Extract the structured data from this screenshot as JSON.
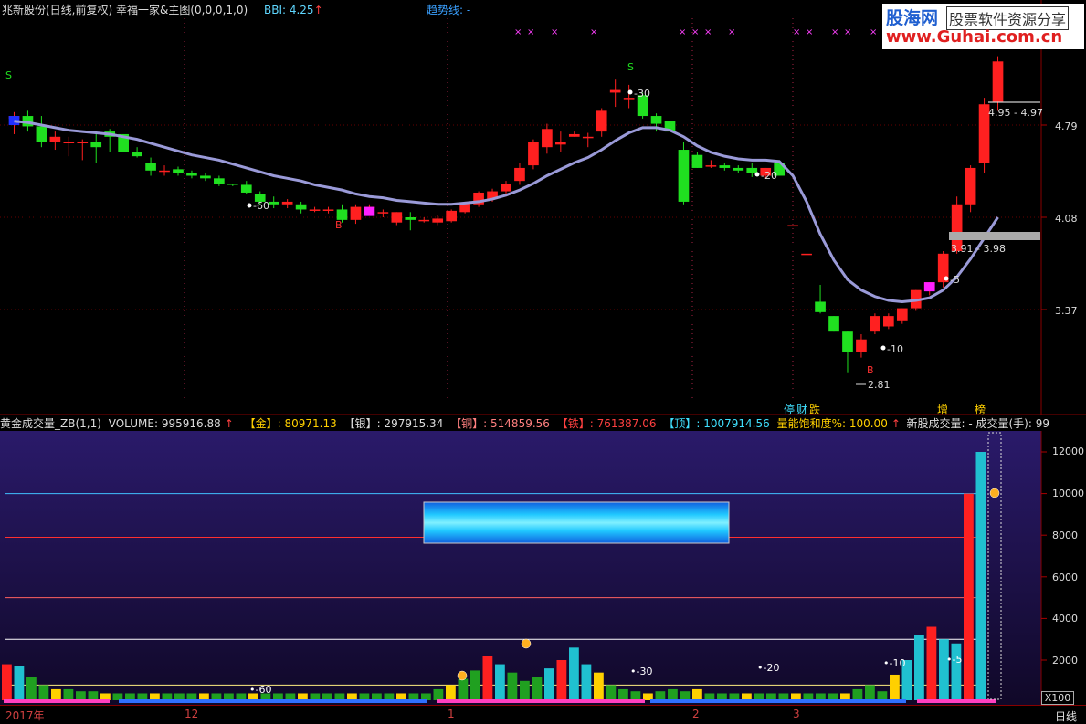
{
  "header": {
    "title": "兆新股份(日线,前复权) 幸福一家&主图(0,0,0,1,0)",
    "bbi_label": "BBI: 4.25",
    "bbi_arrow": "↑",
    "trend_label": "趋势线: -"
  },
  "logo": {
    "line1_cn": "股海网",
    "line1_sub": "股票软件资源分享",
    "line2": "www.Guhai.com.cn"
  },
  "price_axis": {
    "ticks": [
      "4.79",
      "4.08",
      "3.37"
    ]
  },
  "price_annotations": [
    "4.95 - 4.97",
    "3.91 - 3.98",
    "2.81",
    "-60",
    "-30",
    "-20",
    "-10",
    "-5"
  ],
  "signals": {
    "sell": "S",
    "buy": "B"
  },
  "bottom_markers": [
    "停",
    "财",
    "跌",
    "增",
    "榜"
  ],
  "volume_header": {
    "indicator": "黄金成交量_ZB(1,1)",
    "volume": "VOLUME: 995916.88",
    "volume_arrow": "↑",
    "gold": "【金】: 80971.13",
    "silver": "【银】: 297915.34",
    "copper": "【铜】: 514859.56",
    "iron": "【铁】: 761387.06",
    "top": "【顶】: 1007914.56",
    "saturation": "量能饱和度%: 100.00",
    "saturation_arrow": "↑",
    "new_stock": "新股成交量: -  成交量(手): 99"
  },
  "volume_axis": {
    "ticks": [
      "12000",
      "10000",
      "8000",
      "6000",
      "4000",
      "2000"
    ],
    "unit_label": "X100"
  },
  "date_axis": {
    "labels": [
      "2017年",
      "12",
      "1",
      "2",
      "3"
    ],
    "period": "日线"
  },
  "colors": {
    "up": "#ff2020",
    "down": "#20e020",
    "bbi_line": "#9a9ad8",
    "panel_top": "#2a1a6a",
    "panel_bottom": "#100828"
  },
  "chart_data": {
    "type": "candlestick",
    "series": [
      {
        "name": "price",
        "ohlc": [
          [
            4.84,
            4.89,
            4.72,
            4.86
          ],
          [
            4.86,
            4.9,
            4.74,
            4.78
          ],
          [
            4.78,
            4.86,
            4.62,
            4.66
          ],
          [
            4.66,
            4.74,
            4.6,
            4.7
          ],
          [
            4.66,
            4.7,
            4.55,
            4.66
          ],
          [
            4.66,
            4.68,
            4.52,
            4.66
          ],
          [
            4.66,
            4.74,
            4.5,
            4.62
          ],
          [
            4.74,
            4.76,
            4.58,
            4.7
          ],
          [
            4.72,
            4.72,
            4.58,
            4.58
          ],
          [
            4.58,
            4.62,
            4.54,
            4.55
          ],
          [
            4.5,
            4.54,
            4.4,
            4.44
          ],
          [
            4.44,
            4.48,
            4.4,
            4.44
          ],
          [
            4.45,
            4.47,
            4.4,
            4.42
          ],
          [
            4.42,
            4.44,
            4.38,
            4.4
          ],
          [
            4.4,
            4.42,
            4.36,
            4.38
          ],
          [
            4.38,
            4.4,
            4.32,
            4.34
          ],
          [
            4.34,
            4.34,
            4.32,
            4.33
          ],
          [
            4.33,
            4.36,
            4.26,
            4.27
          ],
          [
            4.26,
            4.28,
            4.18,
            4.2
          ],
          [
            4.2,
            4.24,
            4.15,
            4.18
          ],
          [
            4.18,
            4.22,
            4.15,
            4.2
          ],
          [
            4.18,
            4.2,
            4.11,
            4.14
          ],
          [
            4.14,
            4.16,
            4.12,
            4.14
          ],
          [
            4.14,
            4.16,
            4.11,
            4.14
          ],
          [
            4.14,
            4.18,
            4.04,
            4.06
          ],
          [
            4.06,
            4.18,
            4.03,
            4.16
          ],
          [
            4.16,
            4.18,
            4.1,
            4.16
          ],
          [
            4.12,
            4.14,
            4.08,
            4.12
          ],
          [
            4.04,
            4.12,
            4.02,
            4.12
          ],
          [
            4.08,
            4.12,
            3.98,
            4.06
          ],
          [
            4.06,
            4.08,
            4.04,
            4.06
          ],
          [
            4.04,
            4.1,
            4.02,
            4.07
          ],
          [
            4.05,
            4.14,
            4.04,
            4.13
          ],
          [
            4.12,
            4.2,
            4.11,
            4.19
          ],
          [
            4.18,
            4.28,
            4.16,
            4.27
          ],
          [
            4.22,
            4.3,
            4.2,
            4.28
          ],
          [
            4.28,
            4.36,
            4.24,
            4.34
          ],
          [
            4.36,
            4.5,
            4.33,
            4.46
          ],
          [
            4.48,
            4.68,
            4.45,
            4.66
          ],
          [
            4.62,
            4.8,
            4.57,
            4.76
          ],
          [
            4.64,
            4.74,
            4.58,
            4.66
          ],
          [
            4.7,
            4.74,
            4.7,
            4.72
          ],
          [
            4.7,
            4.73,
            4.62,
            4.7
          ],
          [
            4.74,
            4.92,
            4.7,
            4.9
          ],
          [
            5.04,
            5.14,
            4.93,
            5.06
          ],
          [
            5.0,
            5.1,
            4.92,
            5.0
          ],
          [
            5.02,
            5.04,
            4.84,
            4.86
          ],
          [
            4.86,
            4.88,
            4.74,
            4.8
          ],
          [
            4.82,
            4.82,
            4.72,
            4.74
          ],
          [
            4.6,
            4.66,
            4.18,
            4.2
          ],
          [
            4.56,
            4.58,
            4.46,
            4.46
          ],
          [
            4.48,
            4.52,
            4.46,
            4.48
          ],
          [
            4.48,
            4.5,
            4.44,
            4.46
          ],
          [
            4.46,
            4.48,
            4.42,
            4.44
          ],
          [
            4.46,
            4.5,
            4.39,
            4.42
          ],
          [
            4.4,
            4.46,
            4.38,
            4.46
          ],
          [
            4.5,
            4.52,
            4.4,
            4.4
          ],
          [
            4.02,
            4.02,
            4.02,
            4.02
          ],
          [
            3.8,
            3.8,
            3.8,
            3.8
          ],
          [
            3.43,
            3.56,
            3.34,
            3.35
          ],
          [
            3.32,
            3.32,
            3.2,
            3.2
          ],
          [
            3.2,
            3.2,
            2.88,
            3.04
          ],
          [
            3.04,
            3.18,
            3.0,
            3.14
          ],
          [
            3.2,
            3.34,
            3.18,
            3.32
          ],
          [
            3.24,
            3.34,
            3.22,
            3.32
          ],
          [
            3.28,
            3.38,
            3.26,
            3.38
          ],
          [
            3.38,
            3.52,
            3.36,
            3.52
          ],
          [
            3.52,
            3.58,
            3.48,
            3.58
          ],
          [
            3.58,
            3.82,
            3.54,
            3.8
          ],
          [
            3.82,
            4.24,
            3.8,
            4.18
          ],
          [
            4.18,
            4.48,
            4.12,
            4.46
          ],
          [
            4.5,
            5.0,
            4.42,
            4.95
          ],
          [
            4.97,
            5.32,
            4.9,
            5.28
          ]
        ]
      },
      {
        "name": "BBI",
        "values": [
          4.82,
          4.81,
          4.79,
          4.77,
          4.75,
          4.74,
          4.73,
          4.72,
          4.7,
          4.68,
          4.65,
          4.62,
          4.59,
          4.56,
          4.54,
          4.52,
          4.49,
          4.46,
          4.43,
          4.4,
          4.38,
          4.36,
          4.33,
          4.31,
          4.29,
          4.26,
          4.24,
          4.23,
          4.21,
          4.2,
          4.19,
          4.18,
          4.18,
          4.19,
          4.2,
          4.22,
          4.25,
          4.29,
          4.34,
          4.4,
          4.45,
          4.5,
          4.54,
          4.6,
          4.67,
          4.73,
          4.77,
          4.77,
          4.75,
          4.7,
          4.63,
          4.58,
          4.55,
          4.53,
          4.52,
          4.52,
          4.51,
          4.4,
          4.2,
          3.95,
          3.75,
          3.6,
          3.52,
          3.47,
          3.44,
          3.43,
          3.44,
          3.46,
          3.52,
          3.62,
          3.76,
          3.92,
          4.08
        ]
      }
    ],
    "volume": {
      "values": [
        18,
        17,
        12,
        8,
        6,
        6,
        5,
        5,
        4,
        4,
        3,
        3,
        3,
        3,
        3,
        3,
        3,
        3,
        3,
        3,
        3,
        3,
        3,
        3,
        3,
        3,
        3,
        3,
        2,
        2,
        2,
        3,
        3,
        3,
        4,
        6,
        8,
        11,
        15,
        22,
        18,
        14,
        10,
        12,
        16,
        20,
        26,
        18,
        14,
        8,
        6,
        5,
        4,
        5,
        6,
        5,
        6,
        4,
        3,
        3,
        4,
        2,
        3,
        4,
        3,
        3,
        2,
        3,
        4,
        6,
        8,
        5,
        13,
        20,
        32,
        36,
        30,
        28,
        100,
        120
      ],
      "ylim": [
        0,
        13000
      ],
      "ticks": [
        12000,
        10000,
        8000,
        6000,
        4000,
        2000
      ]
    }
  }
}
